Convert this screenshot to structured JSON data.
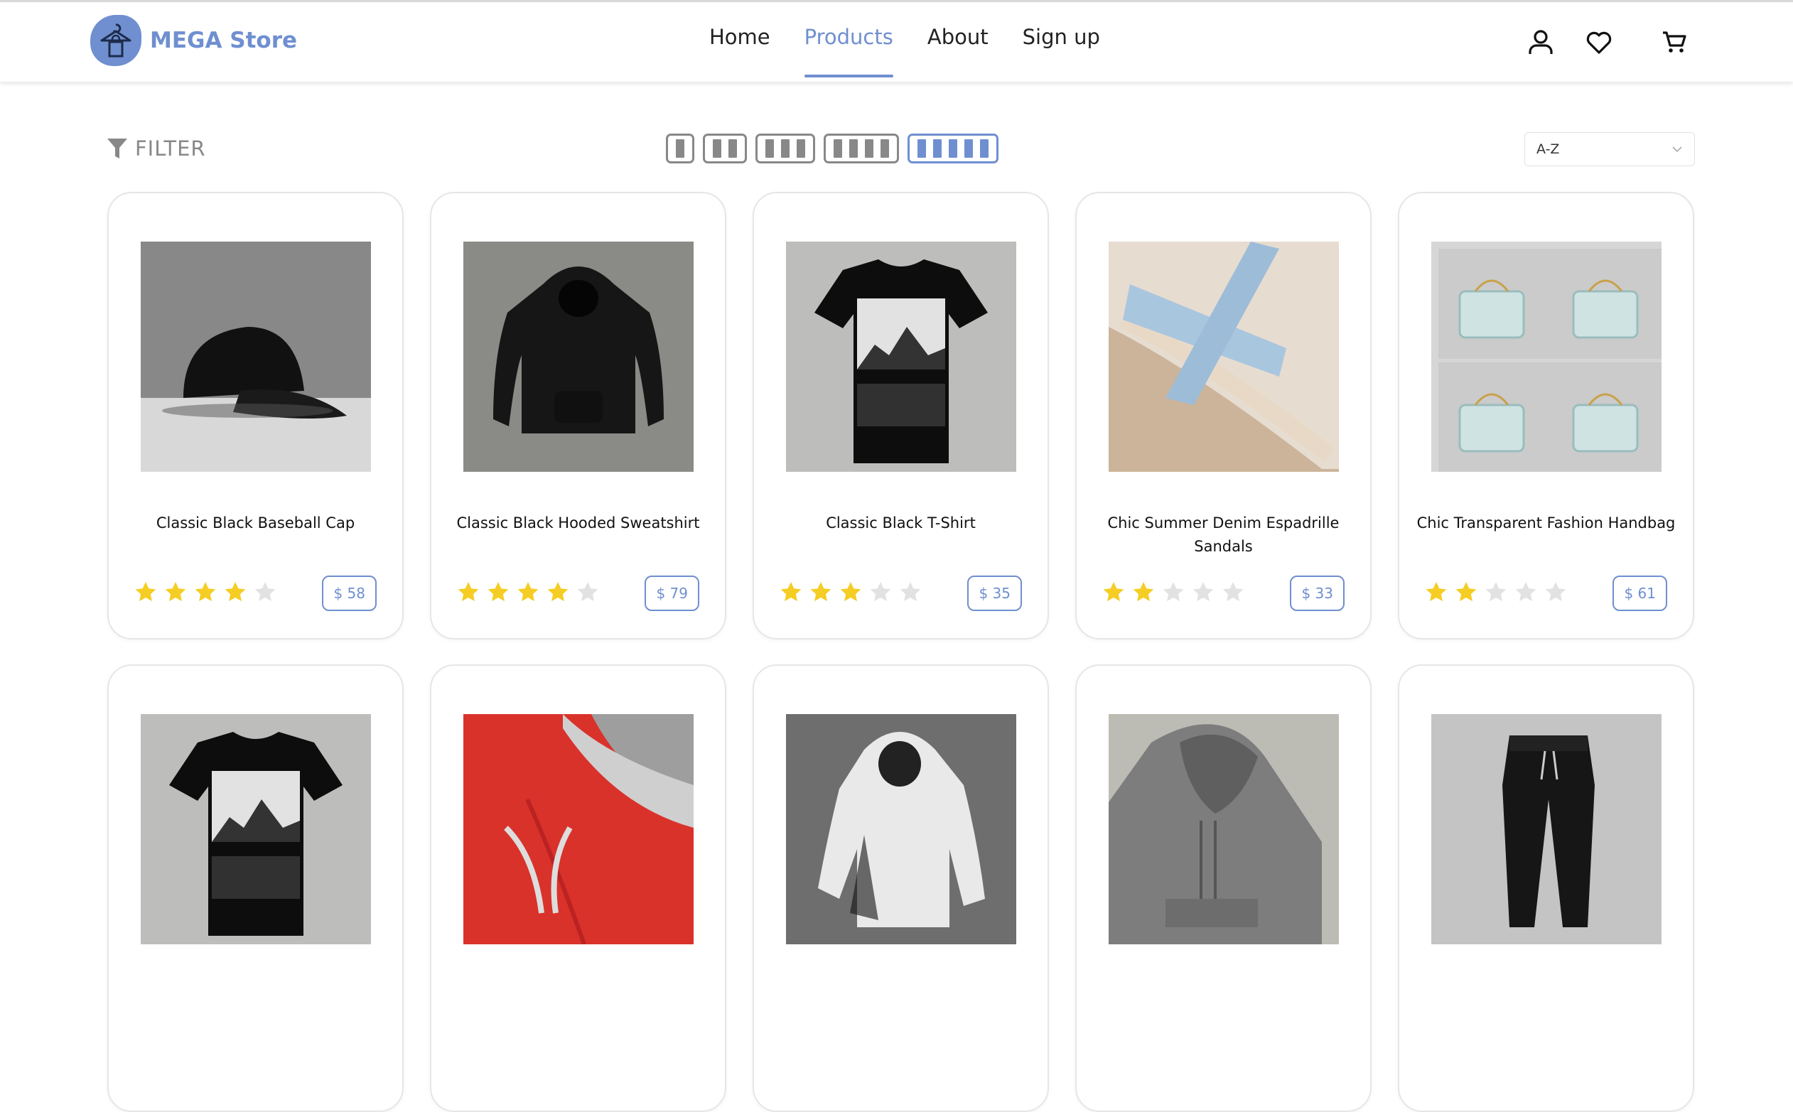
{
  "brand": {
    "name": "MEGA Store",
    "accent_color": "#6f8fd0",
    "logo_icon": "hanger-bag-icon"
  },
  "nav": {
    "items": [
      {
        "label": "Home",
        "active": false
      },
      {
        "label": "Products",
        "active": true
      },
      {
        "label": "About",
        "active": false
      },
      {
        "label": "Sign up",
        "active": false
      }
    ]
  },
  "header_icons": [
    "user-icon",
    "heart-icon",
    "cart-icon"
  ],
  "toolbar": {
    "filter_label": "FILTER",
    "filter_icon": "funnel-icon",
    "layout_options": [
      1,
      2,
      3,
      4,
      5
    ],
    "active_layout": 5,
    "sort": {
      "selected": "A-Z"
    }
  },
  "products": [
    {
      "name": "Classic Black Baseball Cap",
      "rating": 4,
      "price": "$ 58",
      "image": "cap"
    },
    {
      "name": "Classic Black Hooded Sweatshirt",
      "rating": 4,
      "price": "$ 79",
      "image": "hoodie-black"
    },
    {
      "name": "Classic Black T-Shirt",
      "rating": 3,
      "price": "$ 35",
      "image": "tshirt"
    },
    {
      "name": "Chic Summer Denim Espadrille Sandals",
      "rating": 2,
      "price": "$ 33",
      "image": "sandals"
    },
    {
      "name": "Chic Transparent Fashion Handbag",
      "rating": 2,
      "price": "$ 61",
      "image": "handbag"
    },
    {
      "name": "",
      "rating": 0,
      "price": "",
      "image": "tshirt"
    },
    {
      "name": "",
      "rating": 0,
      "price": "",
      "image": "hoodie-red"
    },
    {
      "name": "",
      "rating": 0,
      "price": "",
      "image": "hoodie-white"
    },
    {
      "name": "",
      "rating": 0,
      "price": "",
      "image": "hoodie-gray"
    },
    {
      "name": "",
      "rating": 0,
      "price": "",
      "image": "joggers"
    }
  ]
}
